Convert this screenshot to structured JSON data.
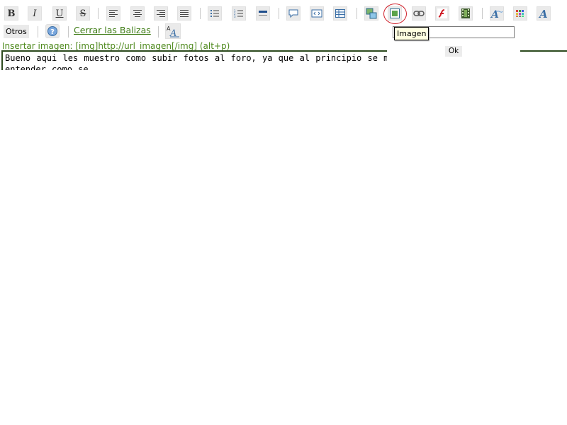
{
  "toolbar_icons": [
    "bold-icon",
    "italic-icon",
    "underline-icon",
    "strikethrough-icon",
    "align-left-icon",
    "align-center-icon",
    "align-right-icon",
    "align-justify-icon",
    "bulleted-list-icon",
    "numbered-list-icon",
    "horizontal-rule-icon",
    "quote-icon",
    "code-icon",
    "table-icon",
    "gallery-icon",
    "image-icon",
    "link-icon",
    "flash-icon",
    "video-icon",
    "font-icon",
    "color-palette-icon",
    "text-style-icon"
  ],
  "format": {
    "bold": "B",
    "italic": "I",
    "underline": "U",
    "strike": "S"
  },
  "toolbar2": {
    "otros_label": "Otros",
    "close_tags_label": "Cerrar las Balizas"
  },
  "hint": "Insertar imagen: [img]http://url_imagen[/img] (alt+p)",
  "editor": {
    "text": "Bueno aqui les muestro como subir fotos al foro, ya que al principio se me hizo un poco complicado entender como se"
  },
  "image_popup": {
    "input_value": "",
    "ok_label": "Ok"
  },
  "tooltip": "Imagen",
  "colors": {
    "link_green": "#3f7d16",
    "hint_green": "#4f8a1e",
    "highlight_red": "#d0202a",
    "editor_border": "#2d4a1f"
  }
}
